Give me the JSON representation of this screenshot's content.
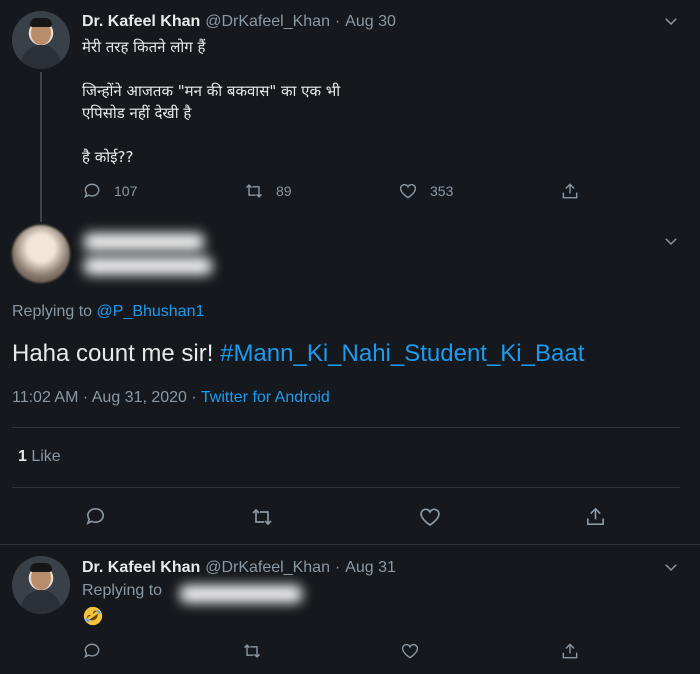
{
  "tweet1": {
    "name": "Dr. Kafeel Khan",
    "handle": "@DrKafeel_Khan",
    "separator": "·",
    "date": "Aug 30",
    "lines": [
      "मेरी तरह कितने लोग हैं",
      "जिन्होंने आजतक \"मन की बकवास\" का एक भी",
      "एपिसोड नहीं देखी है",
      "है कोई??"
    ],
    "reply_count": "107",
    "retweet_count": "89",
    "like_count": "353"
  },
  "tweet2": {
    "replying_prefix": "Replying to",
    "replying_handle": "@P_Bhushan1",
    "text": "Haha count me sir! ",
    "hashtag": "#Mann_Ki_Nahi_Student_Ki_Baat",
    "time": "11:02 AM · Aug 31, 2020 · ",
    "source": "Twitter for Android",
    "like_number": "1",
    "like_label": " Like"
  },
  "tweet3": {
    "name": "Dr. Kafeel Khan",
    "handle": "@DrKafeel_Khan",
    "separator": "·",
    "date": "Aug 31",
    "replying_prefix": "Replying to",
    "emoji": "rolling-on-floor-laughing"
  },
  "colors": {
    "background": "#15181c",
    "accent": "#1d9bf0",
    "muted": "#8b98a5"
  }
}
